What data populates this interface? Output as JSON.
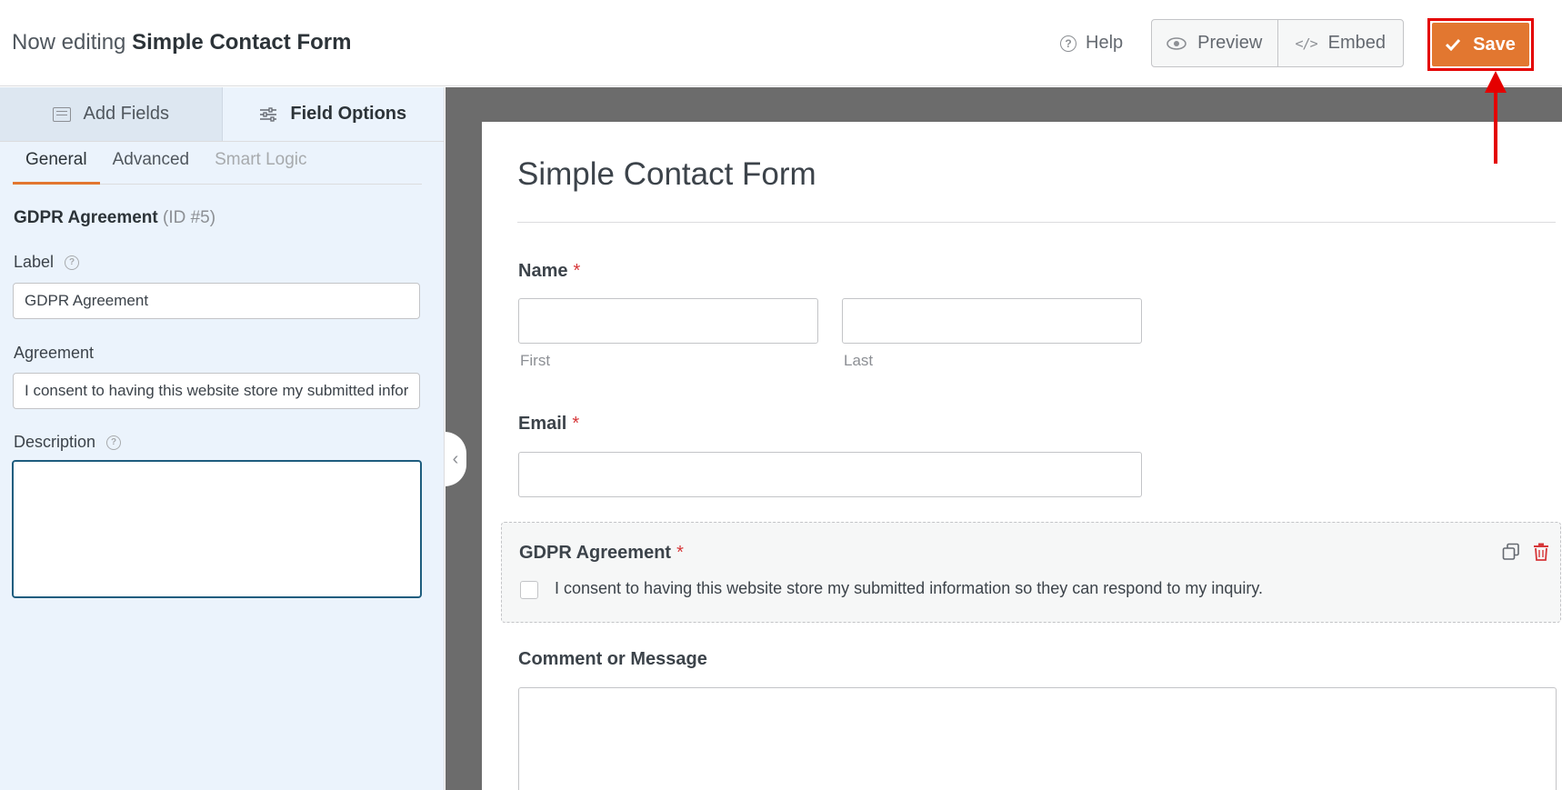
{
  "header": {
    "editing_prefix": "Now editing",
    "form_name": "Simple Contact Form",
    "help_label": "Help",
    "preview_label": "Preview",
    "embed_label": "Embed",
    "save_label": "Save",
    "save_color": "#e27730",
    "highlight_color": "#e40000"
  },
  "sidebar": {
    "tabs": [
      {
        "label": "Add Fields",
        "icon": "list-icon"
      },
      {
        "label": "Field Options",
        "icon": "sliders-icon"
      }
    ],
    "sub_tabs": [
      "General",
      "Advanced",
      "Smart Logic"
    ],
    "field_name": "GDPR Agreement",
    "field_id": "(ID #5)",
    "label_title": "Label",
    "label_value": "GDPR Agreement",
    "agreement_title": "Agreement",
    "agreement_value": "I consent to having this website store my submitted information so they can respond to my inquiry.",
    "description_title": "Description",
    "description_value": ""
  },
  "form": {
    "title": "Simple Contact Form",
    "name_label": "Name",
    "first_label": "First",
    "last_label": "Last",
    "email_label": "Email",
    "required_mark": "*",
    "gdpr_label": "GDPR Agreement",
    "gdpr_text": "I consent to having this website store my submitted information so they can respond to my inquiry.",
    "message_label": "Comment or Message"
  }
}
